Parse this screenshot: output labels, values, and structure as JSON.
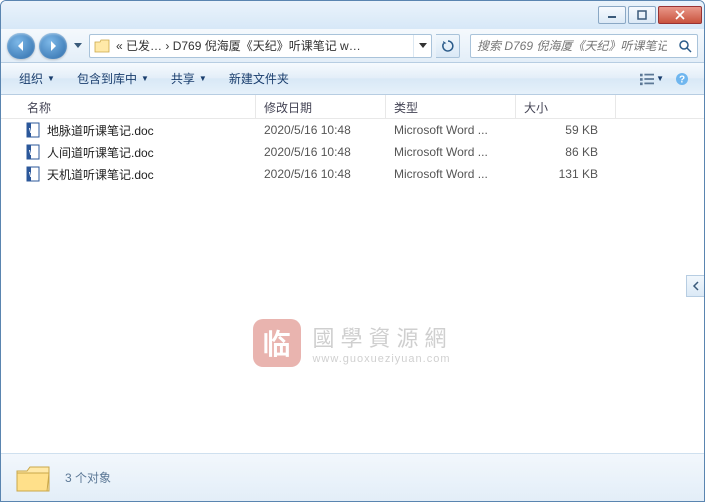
{
  "address": {
    "prefix": "«  已发…",
    "sep": "›",
    "path": "D769 倪海厦《天纪》听课笔记 w…"
  },
  "search": {
    "placeholder": "搜索 D769 倪海厦《天纪》听课笔记 ..."
  },
  "toolbar": {
    "organize": "组织",
    "include": "包含到库中",
    "share": "共享",
    "newfolder": "新建文件夹"
  },
  "columns": {
    "name": "名称",
    "date": "修改日期",
    "type": "类型",
    "size": "大小"
  },
  "files": [
    {
      "name": "地脉道听课笔记.doc",
      "date": "2020/5/16 10:48",
      "type": "Microsoft Word ...",
      "size": "59 KB"
    },
    {
      "name": "人间道听课笔记.doc",
      "date": "2020/5/16 10:48",
      "type": "Microsoft Word ...",
      "size": "86 KB"
    },
    {
      "name": "天机道听课笔记.doc",
      "date": "2020/5/16 10:48",
      "type": "Microsoft Word ...",
      "size": "131 KB"
    }
  ],
  "watermark": {
    "seal": "临",
    "title": "國學資源網",
    "url": "www.guoxueziyuan.com"
  },
  "status": {
    "count": "3 个对象"
  }
}
